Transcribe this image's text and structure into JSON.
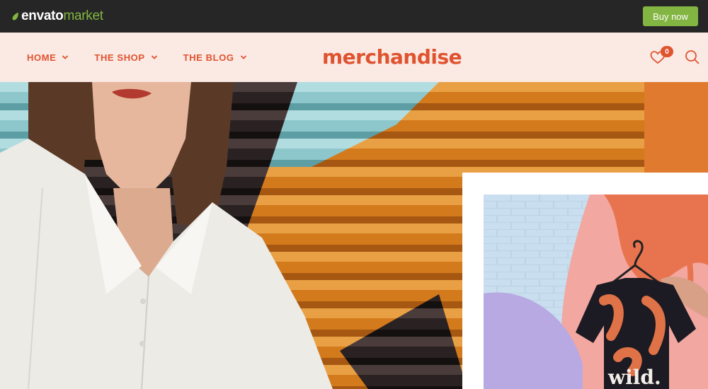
{
  "envato": {
    "brand": "envato",
    "market": "market",
    "buy_now": "Buy now"
  },
  "header": {
    "nav": [
      {
        "label": "HOME"
      },
      {
        "label": "THE SHOP"
      },
      {
        "label": "THE BLOG"
      }
    ],
    "logo": "merchandise",
    "wishlist_count": "0"
  },
  "hero": {
    "shirt_text": "wild."
  },
  "colors": {
    "accent": "#e0532f",
    "header_bg": "#fbe9e4",
    "envato_green": "#82b541",
    "envato_bar": "#262626"
  }
}
